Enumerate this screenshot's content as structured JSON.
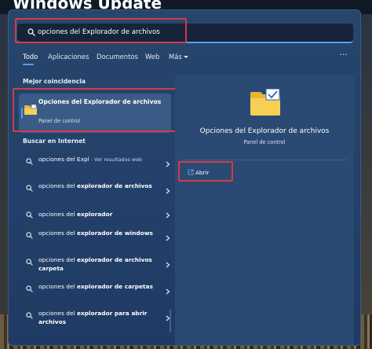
{
  "background": {
    "window_title": "Windows Update"
  },
  "search": {
    "value": "opciones del Explorador de archivos",
    "icon": "search-icon"
  },
  "tabs": [
    {
      "label": "Todo",
      "active": true
    },
    {
      "label": "Aplicaciones",
      "active": false
    },
    {
      "label": "Documentos",
      "active": false
    },
    {
      "label": "Web",
      "active": false
    },
    {
      "label": "Más",
      "active": false
    }
  ],
  "tabs_more_icon": "···",
  "best_match": {
    "section_title": "Mejor coincidencia",
    "title": "Opciones del Explorador de archivos",
    "subtitle": "Panel de control",
    "icon": "folder-icon"
  },
  "web": {
    "section_title": "Buscar en Internet",
    "items": [
      {
        "text": "opciones del Expl",
        "suffix": " - Ver resultados web",
        "bold": false
      },
      {
        "text": "opciones del ",
        "bold_part": "explorador de archivos"
      },
      {
        "text": "opciones del ",
        "bold_part": "explorador"
      },
      {
        "text": "opciones del ",
        "bold_part": "explorador de windows"
      },
      {
        "text": "opciones del ",
        "bold_part": "explorador de archivos carpeta"
      },
      {
        "text": "opciones del ",
        "bold_part": "explorador de carpetas"
      },
      {
        "text": "opciones del ",
        "bold_part": "explorador para abrir archivos"
      }
    ]
  },
  "preview": {
    "title": "Opciones del Explorador de archivos",
    "subtitle": "Panel de control",
    "open_label": "Abrir",
    "icon": "folder-check-icon"
  },
  "colors": {
    "accent": "#5aa0e6",
    "highlight": "#d63a48",
    "panel": "#23406a"
  }
}
